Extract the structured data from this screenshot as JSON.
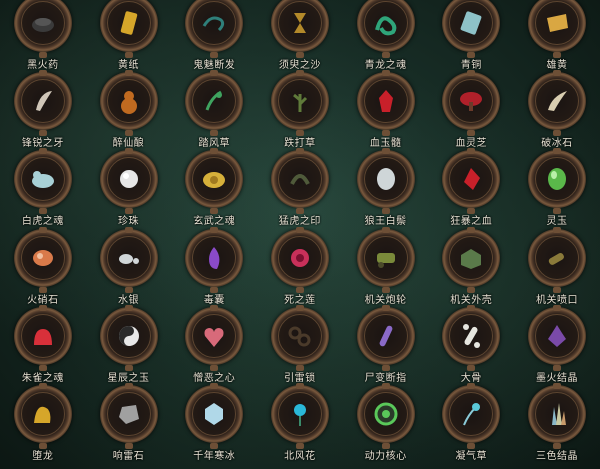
{
  "items": [
    {
      "label": "黑火药",
      "icon": "black-powder-icon",
      "color": "#3a3a3a"
    },
    {
      "label": "黄纸",
      "icon": "yellow-paper-icon",
      "color": "#d6a62a"
    },
    {
      "label": "鬼魅断发",
      "icon": "hair-icon",
      "color": "#2f7f7a"
    },
    {
      "label": "须臾之沙",
      "icon": "hourglass-icon",
      "color": "#b38a2a"
    },
    {
      "label": "青龙之魂",
      "icon": "dragon-icon",
      "color": "#2fa57a"
    },
    {
      "label": "青铜",
      "icon": "bronze-plate-icon",
      "color": "#8ec2c8"
    },
    {
      "label": "雄黄",
      "icon": "realgar-scroll-icon",
      "color": "#d9a742"
    },
    {
      "label": "锋锐之牙",
      "icon": "fang-icon",
      "color": "#cfc6b8"
    },
    {
      "label": "醉仙酿",
      "icon": "gourd-icon",
      "color": "#c06a20"
    },
    {
      "label": "踏风草",
      "icon": "wind-herb-icon",
      "color": "#3fa35f"
    },
    {
      "label": "跌打草",
      "icon": "herb-icon",
      "color": "#5f7a3a"
    },
    {
      "label": "血玉髓",
      "icon": "blood-jade-icon",
      "color": "#c8202a"
    },
    {
      "label": "血灵芝",
      "icon": "lingzhi-icon",
      "color": "#b0202a"
    },
    {
      "label": "破冰石",
      "icon": "horn-icon",
      "color": "#d8cdb0"
    },
    {
      "label": "白虎之魂",
      "icon": "tiger-icon",
      "color": "#a8d0d6"
    },
    {
      "label": "珍珠",
      "icon": "pearl-icon",
      "color": "#e6e6e6"
    },
    {
      "label": "玄武之魂",
      "icon": "turtle-icon",
      "color": "#d6b03a"
    },
    {
      "label": "猛虎之印",
      "icon": "seal-icon",
      "color": "#4f5a3a"
    },
    {
      "label": "狼王白鬃",
      "icon": "white-mane-icon",
      "color": "#cfd6d8"
    },
    {
      "label": "狂暴之血",
      "icon": "blood-crystal-icon",
      "color": "#c8202a"
    },
    {
      "label": "灵玉",
      "icon": "jade-icon",
      "color": "#5ab84a"
    },
    {
      "label": "火硝石",
      "icon": "saltpeter-icon",
      "color": "#d97a4a"
    },
    {
      "label": "水银",
      "icon": "mercury-icon",
      "color": "#d0d6d8"
    },
    {
      "label": "毒囊",
      "icon": "venom-sac-icon",
      "color": "#8a4ac8"
    },
    {
      "label": "死之莲",
      "icon": "death-lotus-icon",
      "color": "#c8305a"
    },
    {
      "label": "机关炮轮",
      "icon": "cannon-wheel-icon",
      "color": "#7a8a3a"
    },
    {
      "label": "机关外壳",
      "icon": "mech-shell-icon",
      "color": "#5a7a4a"
    },
    {
      "label": "机关喷口",
      "icon": "nozzle-icon",
      "color": "#8a7a3a"
    },
    {
      "label": "朱雀之魂",
      "icon": "phoenix-icon",
      "color": "#d8303a"
    },
    {
      "label": "星辰之玉",
      "icon": "yinyang-jade-icon",
      "color": "#e8e8e8"
    },
    {
      "label": "憎恶之心",
      "icon": "heart-icon",
      "color": "#d86a7a"
    },
    {
      "label": "引雷锁",
      "icon": "thunder-chain-icon",
      "color": "#4a3a2a"
    },
    {
      "label": "尸变断指",
      "icon": "finger-icon",
      "color": "#8a6ac8"
    },
    {
      "label": "大骨",
      "icon": "bone-icon",
      "color": "#e6e6e0"
    },
    {
      "label": "墨火结晶",
      "icon": "ink-crystal-icon",
      "color": "#7a4aa8"
    },
    {
      "label": "堕龙",
      "icon": "fallen-dragon-icon",
      "color": "#d6a62a"
    },
    {
      "label": "响雷石",
      "icon": "thunder-stone-icon",
      "color": "#a0a0a0"
    },
    {
      "label": "千年寒冰",
      "icon": "ice-icon",
      "color": "#b0d8e8"
    },
    {
      "label": "北风花",
      "icon": "north-wind-flower-icon",
      "color": "#2ab8d8"
    },
    {
      "label": "动力核心",
      "icon": "power-core-icon",
      "color": "#5ac85a"
    },
    {
      "label": "凝气草",
      "icon": "qi-herb-icon",
      "color": "#5ac8d8"
    },
    {
      "label": "三色结晶",
      "icon": "tricolor-crystal-icon",
      "color": "#c8c8a0"
    }
  ]
}
